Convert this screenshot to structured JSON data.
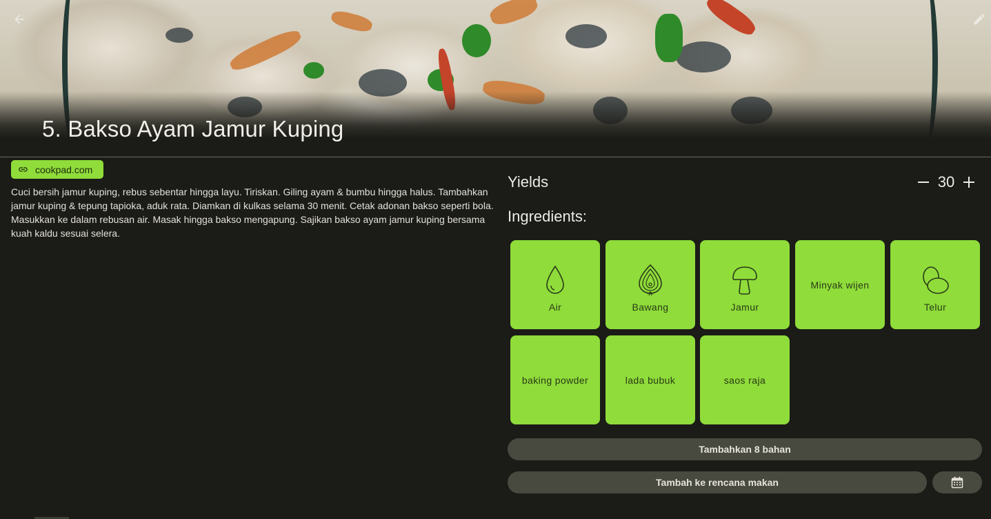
{
  "header": {
    "back_icon": "arrow-left-icon",
    "edit_icon": "pencil-icon",
    "title": "5. Bakso Ayam Jamur Kuping"
  },
  "source": {
    "label": "cookpad.com",
    "icon": "link-icon"
  },
  "description": "Cuci bersih jamur kuping, rebus sebentar hingga layu. Tiriskan. Giling ayam & bumbu hingga halus. Tambahkan jamur kuping & tepung tapioka, aduk rata. Diamkan di kulkas selama 30 menit. Cetak adonan bakso seperti bola. Masukkan ke dalam rebusan air. Masak hingga bakso mengapung. Sajikan bakso ayam jamur kuping bersama kuah kaldu sesuai selera.",
  "yields": {
    "label": "Yields",
    "value": "30",
    "minus_icon": "minus-icon",
    "plus_icon": "plus-icon"
  },
  "ingredients": {
    "label": "Ingredients:",
    "items": [
      {
        "name": "Air",
        "icon": "water-drop-icon"
      },
      {
        "name": "Bawang",
        "icon": "onion-icon"
      },
      {
        "name": "Jamur",
        "icon": "mushroom-icon"
      },
      {
        "name": "Minyak wijen",
        "icon": ""
      },
      {
        "name": "Telur",
        "icon": "eggs-icon"
      },
      {
        "name": "baking powder",
        "icon": ""
      },
      {
        "name": "lada bubuk",
        "icon": ""
      },
      {
        "name": "saos raja",
        "icon": ""
      }
    ]
  },
  "actions": {
    "add_ingredients": "Tambahkan 8 bahan",
    "add_to_meal_plan": "Tambah ke rencana makan",
    "calendar_icon": "calendar-icon"
  },
  "colors": {
    "accent": "#8fdc3a",
    "background": "#1b1b17",
    "button": "#48493f"
  }
}
